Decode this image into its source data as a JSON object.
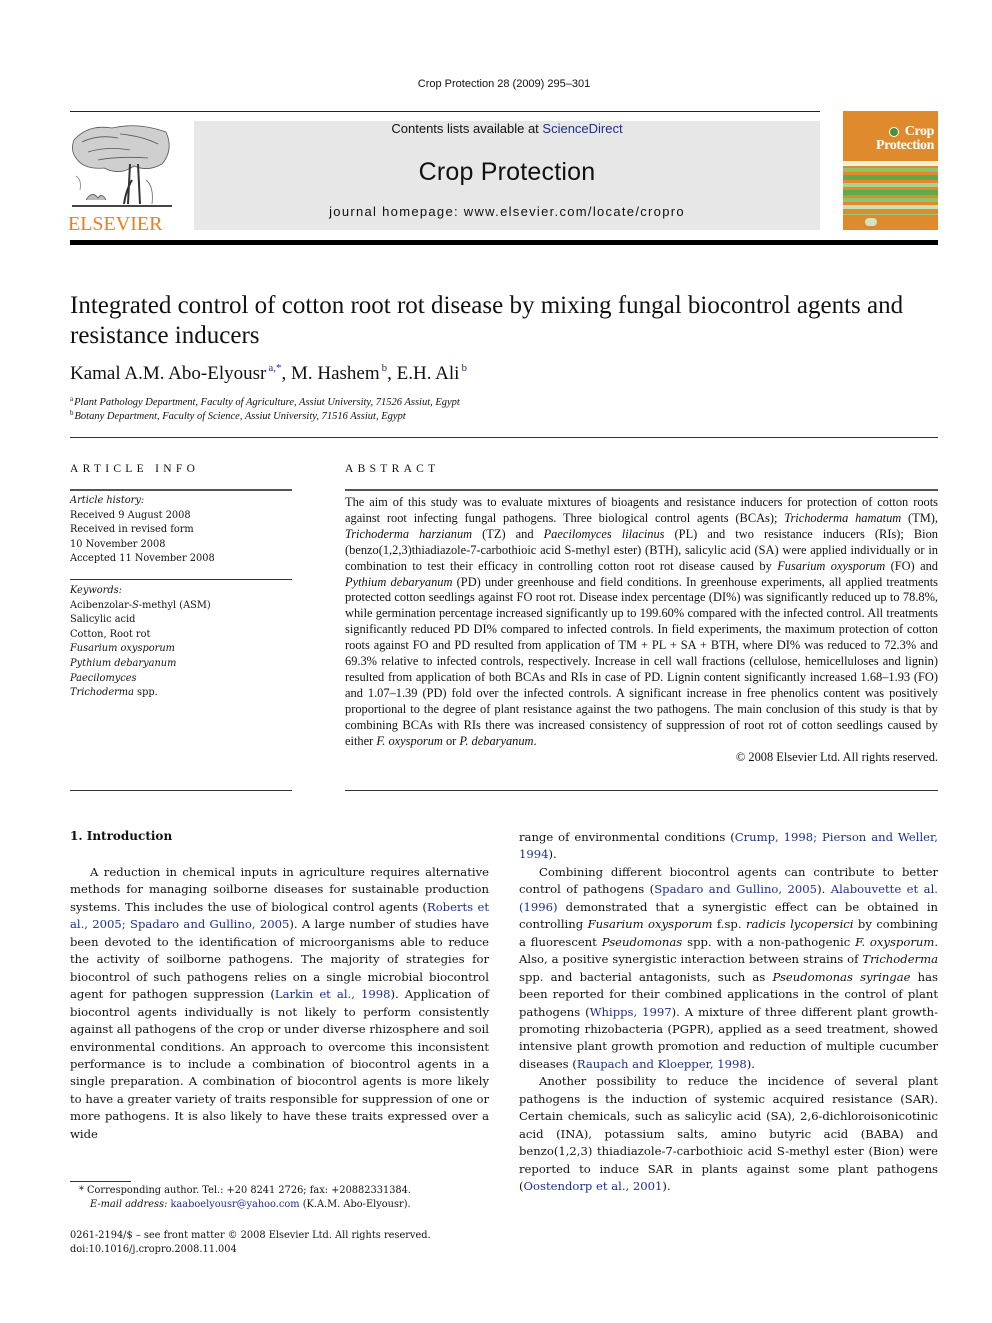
{
  "header": {
    "journal_ref": "Crop Protection 28 (2009) 295–301",
    "contents_prefix": "Contents lists available at ",
    "contents_link": "ScienceDirect",
    "journal_title": "Crop Protection",
    "homepage": "journal homepage: www.elsevier.com/locate/cropro",
    "publisher": "ELSEVIER",
    "cover_title_line1": "Crop",
    "cover_title_line2": "Protection",
    "colors": {
      "elsevier_orange": "#f07d1a",
      "cover_orange": "#e08a2e",
      "cover_green": "#5faa4a",
      "link_blue": "#1d2f8f",
      "banner_gray": "#e7e7e7"
    }
  },
  "article": {
    "title": "Integrated control of cotton root rot disease by mixing fungal biocontrol agents and resistance inducers",
    "authors": [
      {
        "name": "Kamal A.M. Abo-Elyousr",
        "marks": "a,*"
      },
      {
        "name": "M. Hashem",
        "marks": "b"
      },
      {
        "name": "E.H. Ali",
        "marks": "b"
      }
    ],
    "affiliations": [
      {
        "mark": "a",
        "text": "Plant Pathology Department, Faculty of Agriculture, Assiut University, 71526 Assiut, Egypt"
      },
      {
        "mark": "b",
        "text": "Botany Department, Faculty of Science, Assiut University, 71516 Assiut, Egypt"
      }
    ]
  },
  "article_info": {
    "heading": "ARTICLE INFO",
    "history_label": "Article history:",
    "history": [
      "Received 9 August 2008",
      "Received in revised form",
      "10 November 2008",
      "Accepted 11 November 2008"
    ],
    "keywords_label": "Keywords:",
    "keywords": [
      {
        "text": "Acibenzolar-",
        "italic_part": "S",
        "rest": "-methyl (ASM)"
      },
      {
        "text": "Salicylic acid"
      },
      {
        "text": "Cotton, Root rot"
      },
      {
        "italic": "Fusarium oxysporum"
      },
      {
        "italic": "Pythium debaryanum"
      },
      {
        "italic": "Paecilomyces"
      },
      {
        "italic": "Trichoderma",
        "rest": " spp."
      }
    ]
  },
  "abstract": {
    "heading": "ABSTRACT",
    "segments": [
      {
        "t": "The aim of this study was to evaluate mixtures of bioagents and resistance inducers for protection of cotton roots against root infecting fungal pathogens. Three biological control agents (BCAs); "
      },
      {
        "i": "Trichoderma hamatum"
      },
      {
        "t": " (TM), "
      },
      {
        "i": "Trichoderma harzianum"
      },
      {
        "t": " (TZ) and "
      },
      {
        "i": "Paecilomyces lilacinus"
      },
      {
        "t": " (PL) and two resistance inducers (RIs); Bion (benzo(1,2,3)thiadiazole-7-carbothioic acid S-methyl ester) (BTH), salicylic acid (SA) were applied individually or in combination to test their efficacy in controlling cotton root rot disease caused by "
      },
      {
        "i": "Fusarium oxysporum"
      },
      {
        "t": " (FO) and "
      },
      {
        "i": "Pythium debaryanum"
      },
      {
        "t": " (PD) under greenhouse and field conditions. In greenhouse experiments, all applied treatments protected cotton seedlings against FO root rot. Disease index percentage (DI%) was significantly reduced up to 78.8%, while germination percentage increased significantly up to 199.60% compared with the infected control. All treatments significantly reduced PD DI% compared to infected controls. In field experiments, the maximum protection of cotton roots against FO and PD resulted from application of TM + PL + SA + BTH, where DI% was reduced to 72.3% and 69.3% relative to infected controls, respectively. Increase in cell wall fractions (cellulose, hemicelluloses and lignin) resulted from application of both BCAs and RIs in case of PD. Lignin content significantly increased 1.68–1.93 (FO) and 1.07–1.39 (PD) fold over the infected controls. A significant increase in free phenolics content was positively proportional to the degree of plant resistance against the two pathogens. The main conclusion of this study is that by combining BCAs with RIs there was increased consistency of suppression of root rot of cotton seedlings caused by either "
      },
      {
        "i": "F. oxysporum"
      },
      {
        "t": " or "
      },
      {
        "i": "P. debaryanum"
      },
      {
        "t": "."
      }
    ],
    "copyright": "© 2008 Elsevier Ltd. All rights reserved."
  },
  "body": {
    "section_heading": "1.  Introduction",
    "left_paragraphs": [
      [
        {
          "t": "A reduction in chemical inputs in agriculture requires alternative methods for managing soilborne diseases for sustainable production systems. This includes the use of biological control agents ("
        },
        {
          "l": "Roberts et al., 2005; Spadaro and Gullino, 2005"
        },
        {
          "t": "). A large number of studies have been devoted to the identification of microorganisms able to reduce the activity of soilborne pathogens. The majority of strategies for biocontrol of such pathogens relies on a single microbial biocontrol agent for pathogen suppression ("
        },
        {
          "l": "Larkin et al., 1998"
        },
        {
          "t": "). Application of biocontrol agents individually is not likely to perform consistently against all pathogens of the crop or under diverse rhizosphere and soil environmental conditions. An approach to overcome this inconsistent performance is to include a combination of biocontrol agents in a single preparation. A combination of biocontrol agents is more likely to have a greater variety of traits responsible for suppression of one or more pathogens. It is also likely to have these traits expressed over a wide"
        }
      ]
    ],
    "right_paragraphs": [
      [
        {
          "t": "range of environmental conditions ("
        },
        {
          "l": "Crump, 1998; Pierson and Weller, 1994"
        },
        {
          "t": ")."
        }
      ],
      [
        {
          "t": "Combining different biocontrol agents can contribute to better control of pathogens ("
        },
        {
          "l": "Spadaro and Gullino, 2005"
        },
        {
          "t": "). "
        },
        {
          "l": "Alabouvette et al. (1996)"
        },
        {
          "t": " demonstrated that a synergistic effect can be obtained in controlling "
        },
        {
          "i": "Fusarium oxysporum"
        },
        {
          "t": " f.sp. "
        },
        {
          "i": "radicis lycopersici"
        },
        {
          "t": " by combining a fluorescent "
        },
        {
          "i": "Pseudomonas"
        },
        {
          "t": " spp. with a non-pathogenic "
        },
        {
          "i": "F. oxysporum"
        },
        {
          "t": ". Also, a positive synergistic interaction between strains of "
        },
        {
          "i": "Trichoderma"
        },
        {
          "t": " spp. and bacterial antagonists, such as "
        },
        {
          "i": "Pseudomonas syringae"
        },
        {
          "t": " has been reported for their combined applications in the control of plant pathogens ("
        },
        {
          "l": "Whipps, 1997"
        },
        {
          "t": "). A mixture of three different plant growth-promoting rhizobacteria (PGPR), applied as a seed treatment, showed intensive plant growth promotion and reduction of multiple cucumber diseases ("
        },
        {
          "l": "Raupach and Kloepper, 1998"
        },
        {
          "t": ")."
        }
      ],
      [
        {
          "t": "Another possibility to reduce the incidence of several plant pathogens is the induction of systemic acquired resistance (SAR). Certain chemicals, such as salicylic acid (SA), 2,6-dichloroisonicotinic acid (INA), potassium salts, amino butyric acid (BABA) and benzo(1,2,3) thiadiazole-7-carbothioic acid S-methyl ester (Bion) were reported to induce SAR in plants against some plant pathogens ("
        },
        {
          "l": "Oostendorp et al., 2001"
        },
        {
          "t": ")."
        }
      ]
    ]
  },
  "footnotes": {
    "corresponding": "* Corresponding author. Tel.: +20 8241 2726; fax: +20882331384.",
    "email_label": "E-mail address: ",
    "email": "kaaboelyousr@yahoo.com",
    "email_suffix": " (K.A.M. Abo-Elyousr).",
    "issn": "0261-2194/$ – see front matter © 2008 Elsevier Ltd. All rights reserved.",
    "doi": "doi:10.1016/j.cropro.2008.11.004"
  }
}
